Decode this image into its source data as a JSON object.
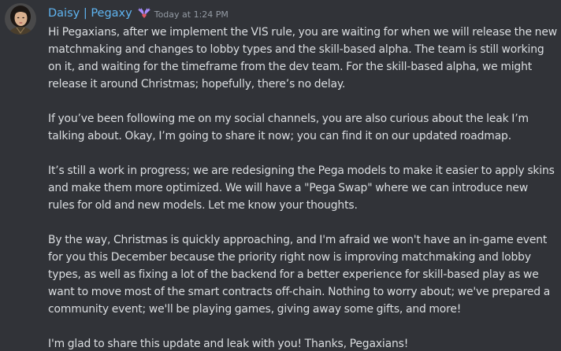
{
  "message": {
    "author": "Daisy | Pegaxy",
    "timestamp": "Today at 1:24 PM",
    "avatar": "avatar-portrait",
    "badge": "pegasus-wings-badge",
    "colors": {
      "username": "#5fb4f0",
      "background": "#313338",
      "text": "#dbdee1",
      "timestamp": "#949ba4",
      "badge_wing": "#a78bfa",
      "badge_heart": "#e25563"
    },
    "paragraphs": [
      "Hi Pegaxians, after we implement the VIS rule, you are waiting for when we will release the new matchmaking and changes to lobby types and the skill-based alpha. The team is still working on it, and waiting for the timeframe from the dev team. For the skill-based alpha, we might release it around Christmas; hopefully, there’s no delay.",
      "If you’ve been following me on my social channels, you are also curious about the leak I’m talking about. Okay, I’m going to share it now; you can find it on our updated roadmap.",
      "It’s still a work in progress; we are redesigning the Pega models to make it easier to apply skins and make them more optimized. We will have a \"Pega Swap\" where we can introduce new rules for old and new models. Let me know your thoughts.",
      "By the way, Christmas is quickly approaching, and I'm afraid we won't have an in-game event for you this December because the priority right now is improving matchmaking and lobby types, as well as fixing a lot of the backend for a better experience for skill-based play as we want to move most of the smart contracts off-chain. Nothing to worry about; we've prepared a community event; we'll be playing games, giving away some gifts, and more!",
      "I'm glad to share this update and leak with you! Thanks, Pegaxians!"
    ]
  }
}
